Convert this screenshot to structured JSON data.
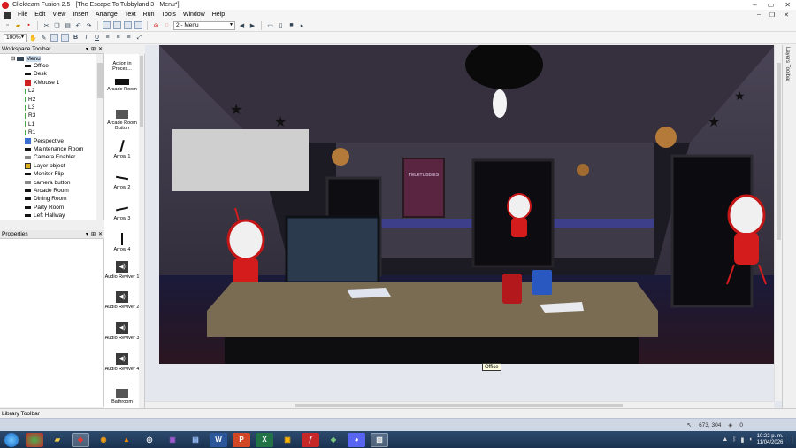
{
  "window": {
    "title": "Clickteam Fusion 2.5 - [The Escape To Tubbyland 3 - Menu*]"
  },
  "menubar": {
    "items": [
      "File",
      "Edit",
      "View",
      "Insert",
      "Arrange",
      "Text",
      "Run",
      "Tools",
      "Window",
      "Help"
    ]
  },
  "toolbar": {
    "frame_select": "2 - Menu",
    "zoom": "100%"
  },
  "workspace": {
    "header": "Workspace Toolbar",
    "root": "Menu",
    "items": [
      {
        "label": "Office",
        "icon": "bar"
      },
      {
        "label": "Desk",
        "icon": "bar"
      },
      {
        "label": "XMouse 1",
        "icon": "red"
      },
      {
        "label": "L2",
        "icon": "line"
      },
      {
        "label": "R2",
        "icon": "line"
      },
      {
        "label": "L3",
        "icon": "line"
      },
      {
        "label": "R3",
        "icon": "line"
      },
      {
        "label": "L1",
        "icon": "line"
      },
      {
        "label": "R1",
        "icon": "line"
      },
      {
        "label": "Perspective",
        "icon": "blue"
      },
      {
        "label": "Maintenance Room",
        "icon": "bar"
      },
      {
        "label": "Camera Enabler",
        "icon": "gray"
      },
      {
        "label": "Layer object",
        "icon": "yellow"
      },
      {
        "label": "Monitor Flip",
        "icon": "bar"
      },
      {
        "label": "camera button",
        "icon": "gray"
      },
      {
        "label": "Arcade Room",
        "icon": "bar"
      },
      {
        "label": "Dining Room",
        "icon": "bar"
      },
      {
        "label": "Party Room",
        "icon": "bar"
      },
      {
        "label": "Left Hallway",
        "icon": "bar"
      }
    ]
  },
  "properties": {
    "header": "Properties"
  },
  "objects": [
    {
      "label": "Action in Proces...",
      "thumb": "none"
    },
    {
      "label": "Arcade Room",
      "thumb": "black"
    },
    {
      "label": "Arcade Room Button",
      "thumb": "gray"
    },
    {
      "label": "Arrow 1",
      "thumb": "a1"
    },
    {
      "label": "Arrow 2",
      "thumb": "a2"
    },
    {
      "label": "Arrow 3",
      "thumb": "a3"
    },
    {
      "label": "Arrow 4",
      "thumb": "a4"
    },
    {
      "label": "Audio Reviver 1",
      "thumb": "audio"
    },
    {
      "label": "Audio Reviver 2",
      "thumb": "audio"
    },
    {
      "label": "Audio Reviver 3",
      "thumb": "audio"
    },
    {
      "label": "Audio Reviver 4",
      "thumb": "audio"
    },
    {
      "label": "Bathroom",
      "thumb": "gray"
    }
  ],
  "editor": {
    "tooltip": "Office",
    "poster_text": "TELETUBBIES"
  },
  "layers": {
    "label": "Layers Toolbar"
  },
  "library": {
    "label": "Library Toolbar"
  },
  "status": {
    "coords": "673, 304",
    "value": "0"
  },
  "taskbar": {
    "time": "10:22 p. m.",
    "date": "11/04/2026"
  }
}
